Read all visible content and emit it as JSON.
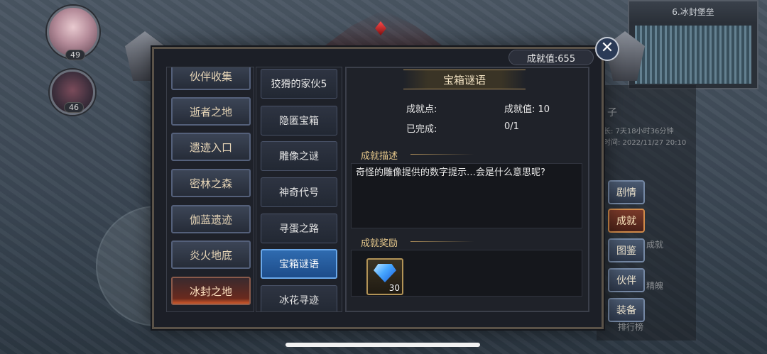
{
  "hud": {
    "avatar1_level": "49",
    "avatar2_level": "46",
    "minimap_title": "6.冰封堡垒",
    "bg_text_zi": "子",
    "bg_text_time1": "长: 7天18小时36分钟",
    "bg_text_time2": "时间: 2022/11/27 20:10",
    "bg_text_chengjiu": "成就",
    "bg_text_jingpo": "精魄",
    "bg_text_paihang": "排行榜"
  },
  "side_tabs": [
    {
      "label": "剧情",
      "active": false
    },
    {
      "label": "成就",
      "active": true
    },
    {
      "label": "图鉴",
      "active": false
    },
    {
      "label": "伙伴",
      "active": false
    },
    {
      "label": "装备",
      "active": false
    }
  ],
  "dialog": {
    "score_label": "成就值:655",
    "close_glyph": "✕",
    "categories": [
      {
        "label": "伙伴收集",
        "active": false
      },
      {
        "label": "逝者之地",
        "active": false
      },
      {
        "label": "遗迹入口",
        "active": false
      },
      {
        "label": "密林之森",
        "active": false
      },
      {
        "label": "伽蓝遗迹",
        "active": false
      },
      {
        "label": "炎火地底",
        "active": false
      },
      {
        "label": "冰封之地",
        "active": true
      }
    ],
    "subitems": [
      {
        "label": "狡猾的家伙5",
        "active": false
      },
      {
        "label": "隐匿宝箱",
        "active": false
      },
      {
        "label": "雕像之谜",
        "active": false
      },
      {
        "label": "神奇代号",
        "active": false
      },
      {
        "label": "寻蛋之路",
        "active": false
      },
      {
        "label": "宝箱谜语",
        "active": true
      },
      {
        "label": "冰花寻迹",
        "active": false
      }
    ],
    "detail": {
      "title": "宝箱谜语",
      "points_label": "成就点:",
      "points_value": "成就值: 10",
      "done_label": "已完成:",
      "done_value": "0/1",
      "desc_head": "成就描述",
      "desc_text": "奇怪的雕像提供的数字提示…会是什么意思呢?",
      "reward_head": "成就奖励",
      "reward_icon": "diamond-icon",
      "reward_count": "30"
    }
  }
}
